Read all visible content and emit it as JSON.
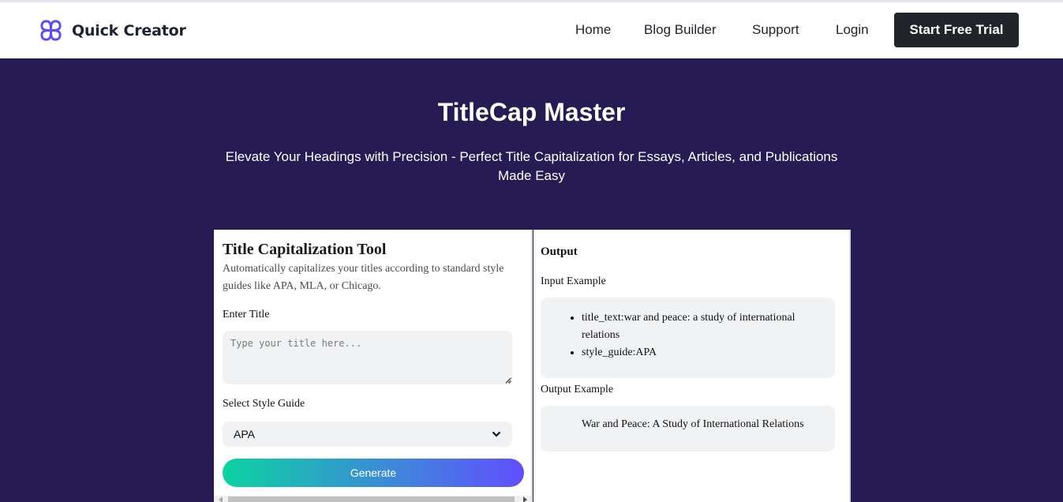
{
  "header": {
    "brand": "Quick Creator",
    "logo_icon": "quad-loop-logo-icon",
    "brand_color": "#5b4cf5",
    "nav": [
      {
        "label": "Home"
      },
      {
        "label": "Blog Builder"
      },
      {
        "label": "Support"
      },
      {
        "label": "Login"
      }
    ],
    "cta_label": "Start Free Trial"
  },
  "hero": {
    "title": "TitleCap Master",
    "subtitle": "Elevate Your Headings with Precision - Perfect Title Capitalization for Essays, Articles, and Publications Made Easy",
    "background_color": "#261b52"
  },
  "tool": {
    "title": "Title Capitalization Tool",
    "description": "Automatically capitalizes your titles according to standard style guides like APA, MLA, or Chicago.",
    "title_field": {
      "label": "Enter Title",
      "placeholder": "Type your title here...",
      "value": ""
    },
    "style_field": {
      "label": "Select Style Guide",
      "selected": "APA"
    },
    "generate_label": "Generate",
    "gradient": {
      "start": "#0cd3a1",
      "end": "#614ffe"
    }
  },
  "output": {
    "title": "Output",
    "input_example_label": "Input Example",
    "input_example_items": [
      "title_text:war and peace: a study of international relations",
      "style_guide:APA"
    ],
    "output_example_label": "Output Example",
    "output_example_text": "War and Peace: A Study of International Relations"
  }
}
